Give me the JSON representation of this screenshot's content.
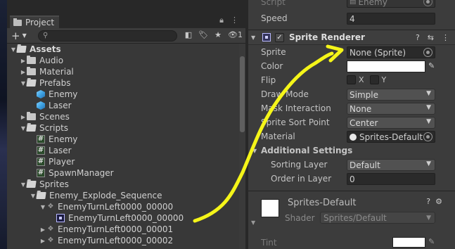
{
  "project": {
    "tab_label": "Project",
    "search_placeholder": "",
    "hidden_count": "1",
    "tree": [
      {
        "label": "Assets",
        "depth": 0,
        "kind": "folder-open",
        "arrow": "down",
        "bold": true
      },
      {
        "label": "Audio",
        "depth": 1,
        "kind": "folder",
        "arrow": "right"
      },
      {
        "label": "Material",
        "depth": 1,
        "kind": "folder",
        "arrow": "right"
      },
      {
        "label": "Prefabs",
        "depth": 1,
        "kind": "folder-open",
        "arrow": "down"
      },
      {
        "label": "Enemy",
        "depth": 2,
        "kind": "prefab",
        "arrow": ""
      },
      {
        "label": "Laser",
        "depth": 2,
        "kind": "prefab",
        "arrow": ""
      },
      {
        "label": "Scenes",
        "depth": 1,
        "kind": "folder",
        "arrow": "right"
      },
      {
        "label": "Scripts",
        "depth": 1,
        "kind": "folder-open",
        "arrow": "down"
      },
      {
        "label": "Enemy",
        "depth": 2,
        "kind": "script",
        "arrow": ""
      },
      {
        "label": "Laser",
        "depth": 2,
        "kind": "script",
        "arrow": ""
      },
      {
        "label": "Player",
        "depth": 2,
        "kind": "script",
        "arrow": ""
      },
      {
        "label": "SpawnManager",
        "depth": 2,
        "kind": "script",
        "arrow": ""
      },
      {
        "label": "Sprites",
        "depth": 1,
        "kind": "folder-open",
        "arrow": "down"
      },
      {
        "label": "Enemy_Explode_Sequence",
        "depth": 2,
        "kind": "folder-open",
        "arrow": "down"
      },
      {
        "label": "EnemyTurnLeft0000_00000",
        "depth": 3,
        "kind": "sprite-sub",
        "arrow": "down"
      },
      {
        "label": "EnemyTurnLeft0000_00000",
        "depth": 4,
        "kind": "sprite-selected",
        "arrow": ""
      },
      {
        "label": "EnemyTurnLeft0000_00001",
        "depth": 3,
        "kind": "sprite-sub",
        "arrow": "right"
      },
      {
        "label": "EnemyTurnLeft0000_00002",
        "depth": 3,
        "kind": "sprite-sub",
        "arrow": "right"
      }
    ]
  },
  "inspector": {
    "script_label": "Script",
    "script_value": "Enemy",
    "speed_label": "Speed",
    "speed_value": "4",
    "component_title": "Sprite Renderer",
    "component_enabled": true,
    "sprite_label": "Sprite",
    "sprite_value": "None (Sprite)",
    "color_label": "Color",
    "color_value": "#ffffff",
    "flip_label": "Flip",
    "flip_x": "X",
    "flip_y": "Y",
    "draw_mode_label": "Draw Mode",
    "draw_mode_value": "Simple",
    "mask_label": "Mask Interaction",
    "mask_value": "None",
    "sort_point_label": "Sprite Sort Point",
    "sort_point_value": "Center",
    "material_label": "Material",
    "material_value": "Sprites-Default",
    "additional_label": "Additional Settings",
    "sorting_layer_label": "Sorting Layer",
    "sorting_layer_value": "Default",
    "order_label": "Order in Layer",
    "order_value": "0",
    "mat_name": "Sprites-Default",
    "shader_label": "Shader",
    "shader_value": "Sprites/Default",
    "tint_label": "Tint"
  },
  "annotation": {
    "color": "#f5f519"
  }
}
